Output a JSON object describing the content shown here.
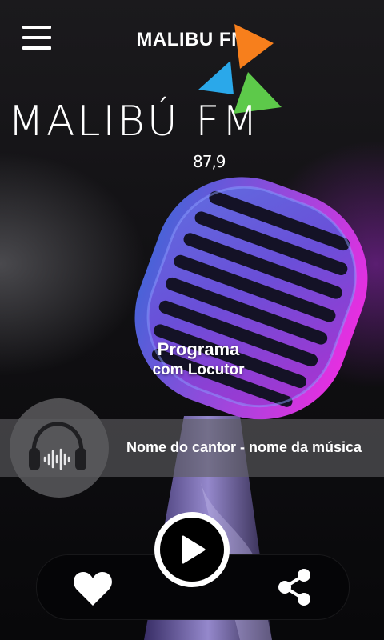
{
  "header": {
    "menu_icon": "hamburger-menu-icon",
    "title": "MALIBU FM"
  },
  "logo": {
    "name": "MALIBÚ FM",
    "frequency": "87,9",
    "colors": [
      "#f77f1c",
      "#2aa8ea",
      "#5dc94a"
    ]
  },
  "program": {
    "name": "Programa",
    "host": "com Locutor"
  },
  "now_playing": {
    "icon": "headphones-icon",
    "track": "Nome do cantor - nome da música"
  },
  "controls": {
    "like_icon": "heart-icon",
    "play_icon": "play-icon",
    "share_icon": "share-icon"
  }
}
